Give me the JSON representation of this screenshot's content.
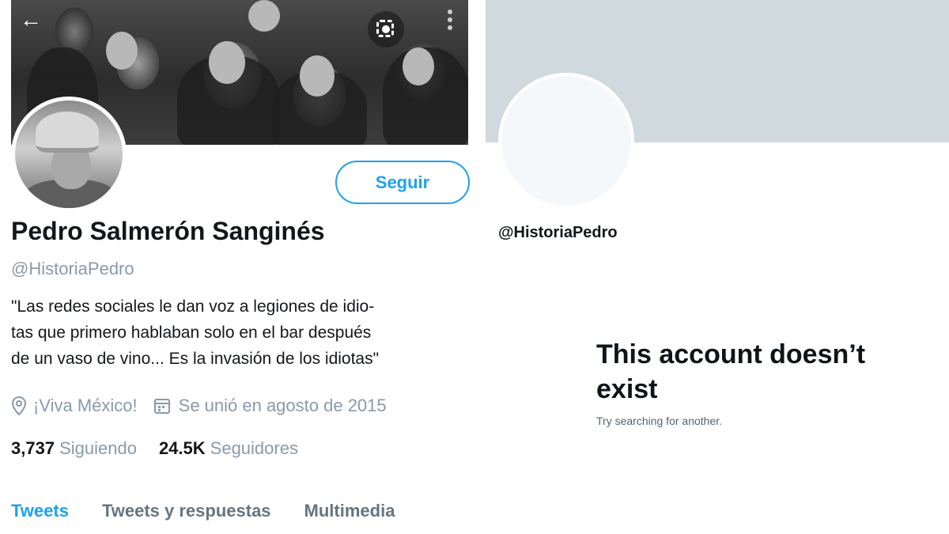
{
  "left": {
    "name": "Pedro Salmerón Sanginés",
    "handle": "@HistoriaPedro",
    "follow_label": "Seguir",
    "bio": [
      "\"Las redes sociales le dan voz a legiones de idio-",
      "tas que primero hablaban solo en el bar después",
      "de un vaso de vino... Es la invasión de los idiotas\""
    ],
    "location": "¡Viva México!",
    "joined": "Se unió en agosto de 2015",
    "following_count": "3,737",
    "following_label": "Siguiendo",
    "followers_count": "24.5K",
    "followers_label": "Seguidores",
    "tabs": [
      "Tweets",
      "Tweets y respuestas",
      "Multimedia"
    ],
    "active_tab": "Tweets",
    "icons": {
      "back": "arrow-left-icon",
      "lens": "lens-icon",
      "more": "more-vertical-icon",
      "location": "location-pin-icon",
      "calendar": "calendar-icon"
    },
    "colors": {
      "accent": "#1da1f2",
      "muted": "#8a9aa8"
    }
  },
  "right": {
    "handle": "@HistoriaPedro",
    "title": "This account doesn’t exist",
    "subtitle": "Try searching for another.",
    "colors": {
      "banner": "#cfd9de"
    }
  }
}
